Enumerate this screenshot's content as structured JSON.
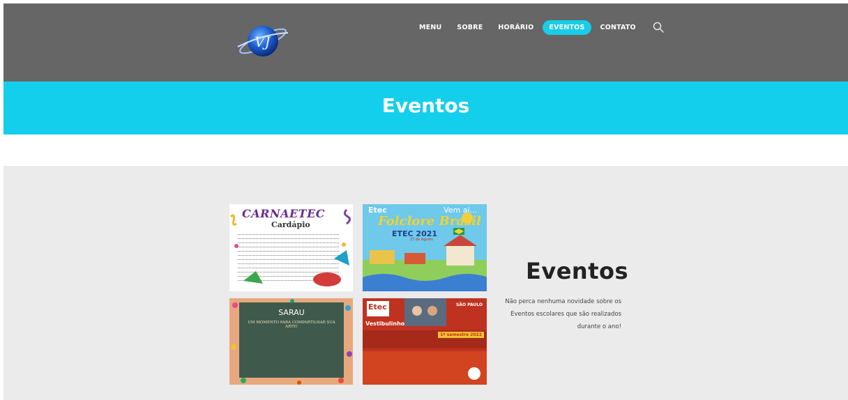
{
  "colors": {
    "header_bg": "#666666",
    "accent": "#17cde8",
    "banner_bg": "#13cfec",
    "section_bg": "#ebebeb"
  },
  "header": {
    "logo_text": "VJ",
    "nav": [
      {
        "label": "MENU",
        "active": false
      },
      {
        "label": "SOBRE",
        "active": false
      },
      {
        "label": "HORÁRIO",
        "active": false
      },
      {
        "label": "EVENTOS",
        "active": true
      },
      {
        "label": "CONTATO",
        "active": false
      }
    ],
    "search_icon": "search-icon"
  },
  "banner": {
    "title": "Eventos"
  },
  "gallery": [
    {
      "title": "CARNAETEC",
      "subtitle": "Cardápio"
    },
    {
      "top_label": "Etec",
      "tag": "Vem ai...",
      "title": "Folclore Brasil",
      "subtitle": "ETEC 2021",
      "date": "27 de Agosto"
    },
    {
      "title": "SARAU",
      "subtitle": "UM MOMENTO PARA COMPARTILHAR SUA ARTE!"
    },
    {
      "logo": "Etec",
      "gov": "SÃO PAULO",
      "title": "Vestibulinho",
      "badge": "1º semestre 2022"
    }
  ],
  "events": {
    "title": "Eventos",
    "description": "Não perca nenhuma novidade sobre os Eventos escolares que são realizados durante o ano!"
  }
}
